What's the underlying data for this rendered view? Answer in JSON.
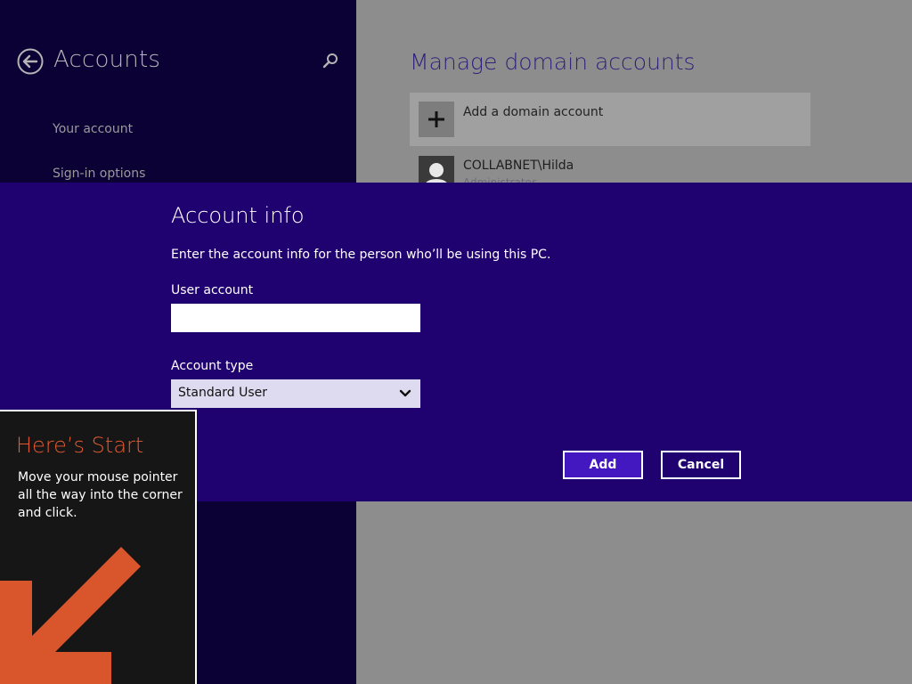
{
  "sidebar": {
    "title": "Accounts",
    "items": [
      {
        "label": "Your account"
      },
      {
        "label": "Sign-in options"
      }
    ]
  },
  "main": {
    "heading": "Manage domain accounts",
    "add_account_label": "Add a domain account",
    "users": [
      {
        "name": "COLLABNET\\Hilda",
        "role": "Administrator"
      }
    ]
  },
  "dialog": {
    "title": "Account info",
    "description": "Enter the account info for the person who’ll be using this PC.",
    "user_account_label": "User account",
    "user_account_value": "",
    "account_type_label": "Account type",
    "account_type_value": "Standard User",
    "add_label": "Add",
    "cancel_label": "Cancel"
  },
  "start_tip": {
    "title": "Here’s Start",
    "body": "Move your mouse pointer all the way into the corner and click."
  },
  "icons": {
    "back": "back-arrow-icon",
    "search": "search-icon",
    "add": "plus-icon",
    "avatar": "user-avatar-icon",
    "dropdown": "chevron-down-icon",
    "tip_arrow": "arrow-down-left-icon"
  },
  "colors": {
    "left_pane": "#0b0135",
    "right_pane": "#8d8d8d",
    "dialog_band": "#1f0270",
    "add_button": "#4318c0",
    "tip_title": "#e35a30",
    "tip_arrow": "#d9562c"
  }
}
